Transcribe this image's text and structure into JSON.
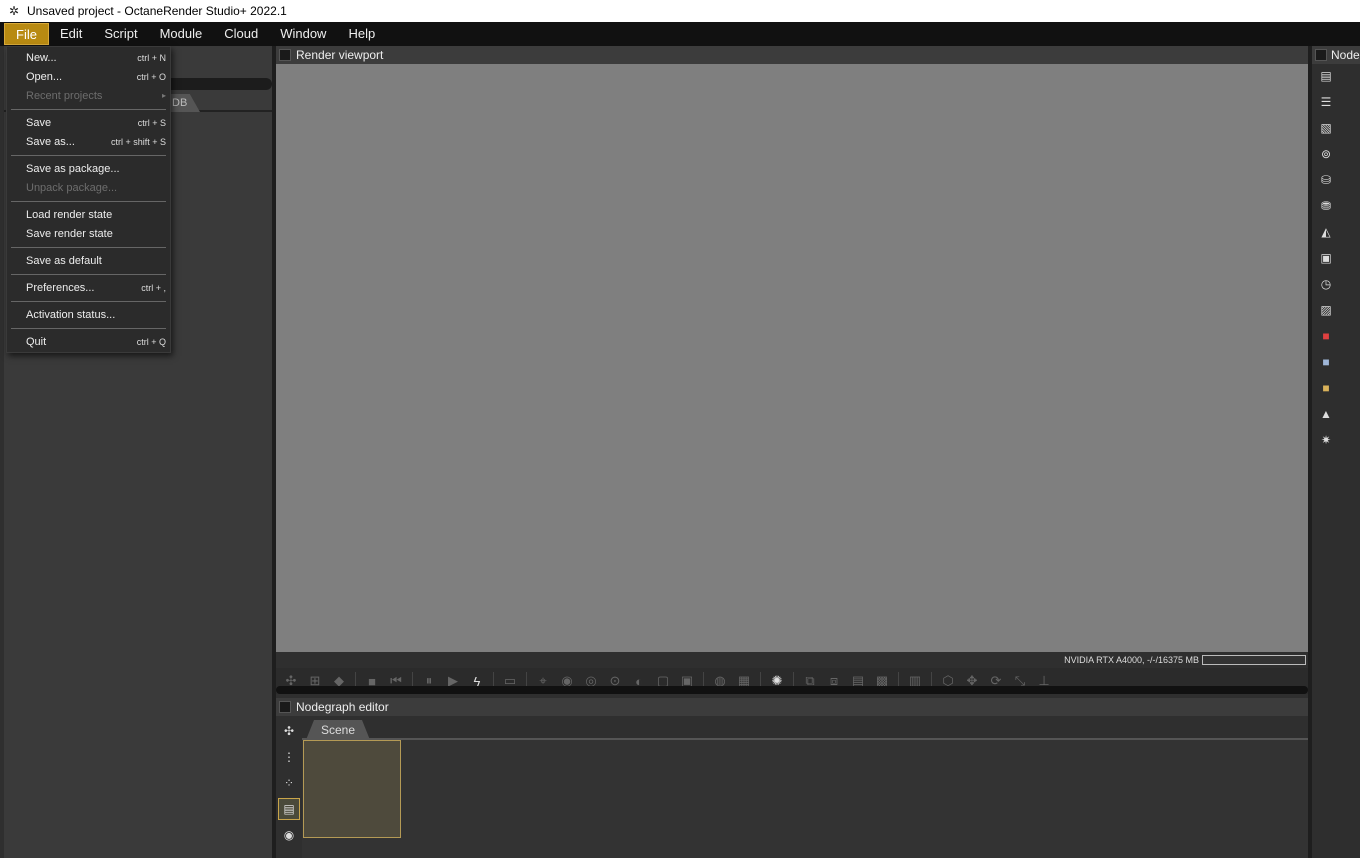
{
  "window": {
    "title": "Unsaved project - OctaneRender Studio+ 2022.1",
    "app_icon": "octane-logo-icon"
  },
  "menubar": {
    "items": [
      "File",
      "Edit",
      "Script",
      "Module",
      "Cloud",
      "Window",
      "Help"
    ],
    "active": "File"
  },
  "file_menu": {
    "new": {
      "label": "New...",
      "shortcut": "ctrl + N"
    },
    "open": {
      "label": "Open...",
      "shortcut": "ctrl + O"
    },
    "recent": {
      "label": "Recent projects"
    },
    "save": {
      "label": "Save",
      "shortcut": "ctrl + S"
    },
    "save_as": {
      "label": "Save as...",
      "shortcut": "ctrl + shift + S"
    },
    "save_package": {
      "label": "Save as package..."
    },
    "unpack_package": {
      "label": "Unpack package..."
    },
    "load_render_state": {
      "label": "Load render state"
    },
    "save_render_state": {
      "label": "Save render state"
    },
    "save_default": {
      "label": "Save as default"
    },
    "preferences": {
      "label": "Preferences...",
      "shortcut": "ctrl + ,"
    },
    "activation": {
      "label": "Activation status..."
    },
    "quit": {
      "label": "Quit",
      "shortcut": "ctrl + Q"
    }
  },
  "left_panel": {
    "tab_fragment": "DB"
  },
  "viewport": {
    "title": "Render viewport",
    "gpu_status": "NVIDIA RTX A4000, -/-/16375 MB"
  },
  "nodegraph": {
    "title": "Nodegraph editor",
    "tab": "Scene"
  },
  "right_panel": {
    "title": "Node"
  },
  "colors": {
    "menu_active": "#b88a12",
    "viewport_bg": "#7f7f7f",
    "node_border": "#b49a55"
  }
}
